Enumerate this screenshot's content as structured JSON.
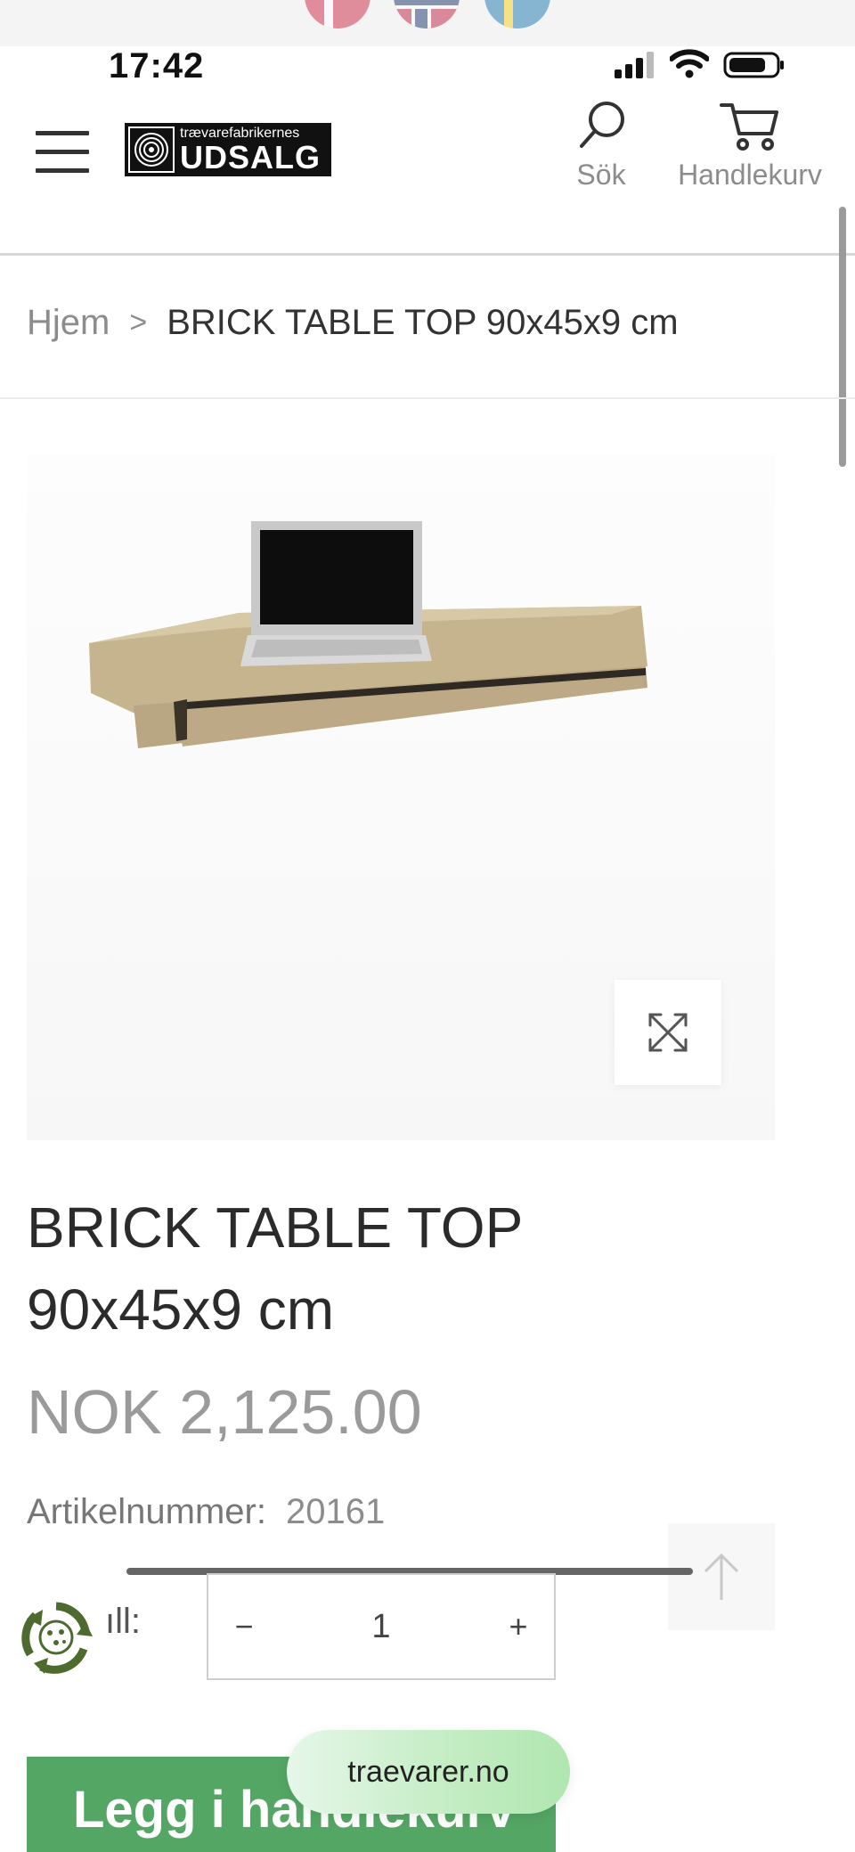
{
  "status_bar": {
    "time": "17:42"
  },
  "header": {
    "logo_small": "trævarefabrikernes",
    "logo_big": "UDSALG",
    "search_label": "Sök",
    "cart_label": "Handlekurv"
  },
  "breadcrumb": {
    "home": "Hjem",
    "separator": ">",
    "current": "BRICK TABLE TOP 90x45x9 cm"
  },
  "product": {
    "title": "BRICK TABLE TOP 90x45x9 cm",
    "price": "NOK 2,125.00",
    "article_label": "Artikelnummer:",
    "article_number": "20161",
    "quantity_label": "ıll:",
    "quantity_minus": "−",
    "quantity_value": "1",
    "quantity_plus": "+",
    "add_to_cart": "Legg i handlekurv"
  },
  "site_pill": "traevarer.no",
  "colors": {
    "accent_green": "#54a664",
    "text_dark": "#2b2b2b",
    "text_muted": "#8c8c8c"
  },
  "icons": [
    "menu-icon",
    "search-icon",
    "cart-icon",
    "expand-icon",
    "arrow-up-icon",
    "recycle-icon"
  ]
}
